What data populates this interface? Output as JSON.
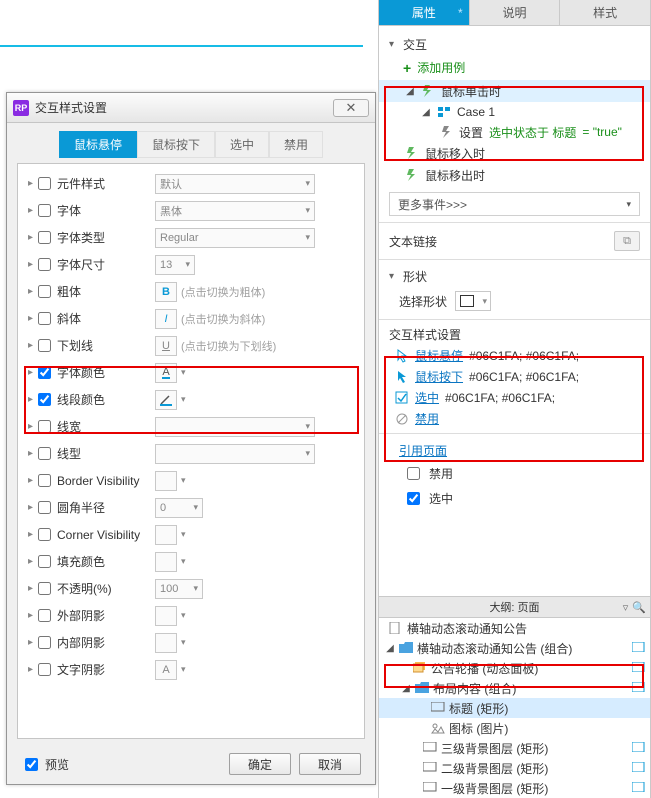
{
  "dialog": {
    "title": "交互样式设置",
    "logo": "RP",
    "tabs": [
      "鼠标悬停",
      "鼠标按下",
      "选中",
      "禁用"
    ],
    "active_tab": 0,
    "props": {
      "element_style": {
        "label": "元件样式",
        "value": "默认"
      },
      "font": {
        "label": "字体",
        "value": "黑体"
      },
      "font_type": {
        "label": "字体类型",
        "value": "Regular"
      },
      "font_size": {
        "label": "字体尺寸",
        "value": "13"
      },
      "bold": {
        "label": "粗体",
        "icon": "B",
        "hint": "(点击切换为粗体)"
      },
      "italic": {
        "label": "斜体",
        "icon": "I",
        "hint": "(点击切换为斜体)"
      },
      "underline": {
        "label": "下划线",
        "icon": "U",
        "hint": "(点击切换为下划线)"
      },
      "font_color": {
        "label": "字体颜色",
        "icon": "A",
        "checked": true
      },
      "line_color": {
        "label": "线段颜色",
        "checked": true
      },
      "line_width": {
        "label": "线宽"
      },
      "line_style": {
        "label": "线型"
      },
      "border_vis": {
        "label": "Border Visibility"
      },
      "radius": {
        "label": "圆角半径",
        "value": "0"
      },
      "corner_vis": {
        "label": "Corner Visibility"
      },
      "fill_color": {
        "label": "填充颜色"
      },
      "opacity": {
        "label": "不透明(%)",
        "value": "100"
      },
      "outer_shadow": {
        "label": "外部阴影"
      },
      "inner_shadow": {
        "label": "内部阴影"
      },
      "text_shadow": {
        "label": "文字阴影",
        "icon": "A"
      }
    },
    "preview_label": "预览",
    "ok": "确定",
    "cancel": "取消"
  },
  "panel": {
    "tabs": [
      "属性",
      "说明",
      "样式"
    ],
    "active_tab": 0,
    "star": "*",
    "sections": {
      "interaction": "交互",
      "add_case": "添加用例",
      "events": {
        "click": "鼠标单击时",
        "case1": "Case 1",
        "action_prefix": "设置",
        "action_mid": "选中状态于 标题",
        "action_suffix": "= \"true\"",
        "mousein": "鼠标移入时",
        "mouseout": "鼠标移出时"
      },
      "more_events": "更多事件>>>",
      "text_link": "文本链接",
      "shape": "形状",
      "select_shape": "选择形状",
      "ix_style": "交互样式设置",
      "ix_hover": "鼠标悬停",
      "ix_press": "鼠标按下",
      "ix_selected": "选中",
      "ix_disable": "禁用",
      "ix_colors": "#06C1FA; #06C1FA;",
      "ref_page": "引用页面",
      "disable_cb": "禁用",
      "selected_cb": "选中"
    }
  },
  "outline": {
    "title": "大纲: 页面",
    "items": {
      "doc": "横轴动态滚动通知公告",
      "group1": "横轴动态滚动通知公告 (组合)",
      "dynpanel": "公告轮播 (动态面板)",
      "layout_group": "布局内容 (组合)",
      "title_shape": "标题 (矩形)",
      "icon_img": "图标 (图片)",
      "bg3": "三级背景图层 (矩形)",
      "bg2": "二级背景图层 (矩形)",
      "bg1": "一级背景图层 (矩形)"
    }
  }
}
